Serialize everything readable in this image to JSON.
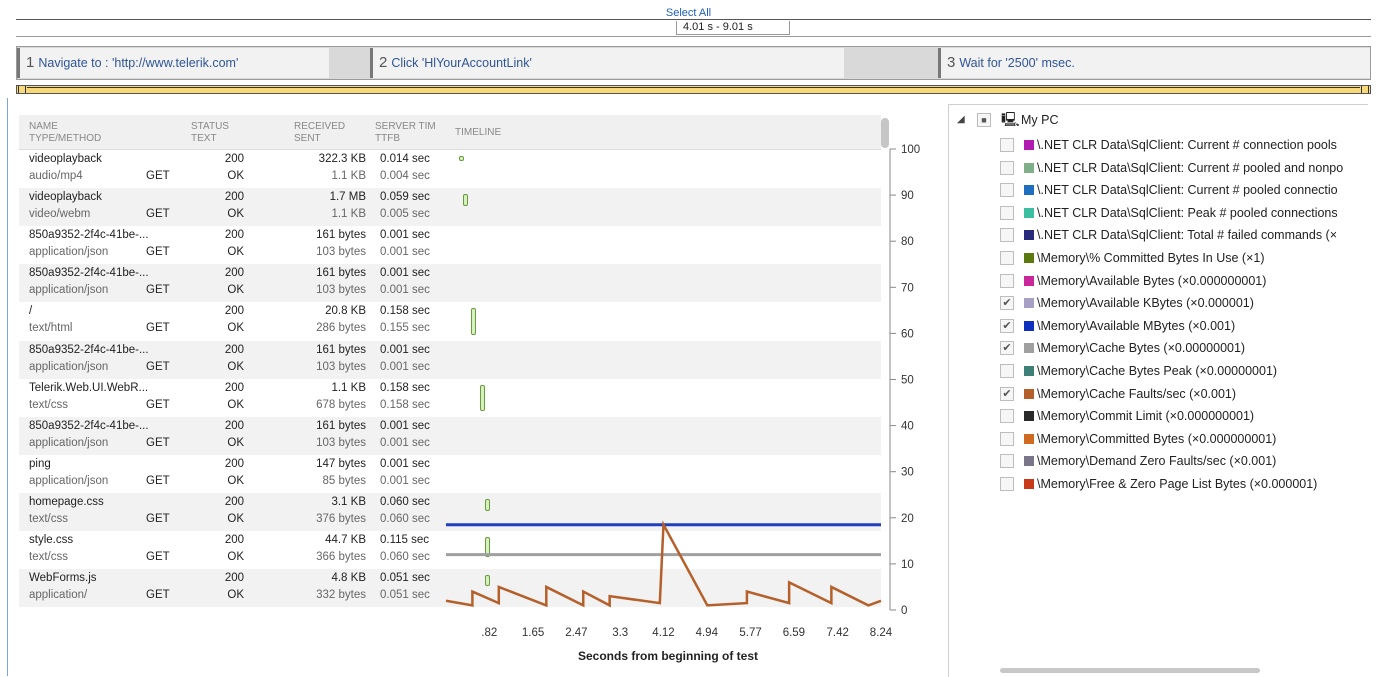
{
  "top": {
    "select_all": "Select All",
    "range": "4.01 s - 9.01 s"
  },
  "steps": [
    {
      "num": "1",
      "label": "Navigate to : 'http://www.telerik.com'"
    },
    {
      "num": "2",
      "label": "Click 'HlYourAccountLink'"
    },
    {
      "num": "3",
      "label": "Wait for '2500' msec."
    }
  ],
  "table": {
    "headers": {
      "name": "NAME",
      "type": "TYPE/METHOD",
      "status": "STATUS",
      "text": "TEXT",
      "received": "RECEIVED",
      "sent": "SENT",
      "server": "SERVER TIM",
      "ttfb": "TTFB",
      "timeline": "TIMELINE"
    },
    "rows": [
      {
        "name": "videoplayback",
        "type": "audio/mp4",
        "method": "GET",
        "status": "200",
        "text": "OK",
        "received": "322.3 KB",
        "sent": "1.1 KB",
        "server": "0.014 sec",
        "ttfb": "0.004 sec"
      },
      {
        "name": "videoplayback",
        "type": "video/webm",
        "method": "GET",
        "status": "200",
        "text": "OK",
        "received": "1.7 MB",
        "sent": "1.1 KB",
        "server": "0.059 sec",
        "ttfb": "0.005 sec"
      },
      {
        "name": "850a9352-2f4c-41be-...",
        "type": "application/json",
        "method": "GET",
        "status": "200",
        "text": "OK",
        "received": "161 bytes",
        "sent": "103 bytes",
        "server": "0.001 sec",
        "ttfb": "0.001 sec"
      },
      {
        "name": "850a9352-2f4c-41be-...",
        "type": "application/json",
        "method": "GET",
        "status": "200",
        "text": "OK",
        "received": "161 bytes",
        "sent": "103 bytes",
        "server": "0.001 sec",
        "ttfb": "0.001 sec"
      },
      {
        "name": "/",
        "type": "text/html",
        "method": "GET",
        "status": "200",
        "text": "OK",
        "received": "20.8 KB",
        "sent": "286 bytes",
        "server": "0.158 sec",
        "ttfb": "0.155 sec"
      },
      {
        "name": "850a9352-2f4c-41be-...",
        "type": "application/json",
        "method": "GET",
        "status": "200",
        "text": "OK",
        "received": "161 bytes",
        "sent": "103 bytes",
        "server": "0.001 sec",
        "ttfb": "0.001 sec"
      },
      {
        "name": "Telerik.Web.UI.WebR...",
        "type": "text/css",
        "method": "GET",
        "status": "200",
        "text": "OK",
        "received": "1.1 KB",
        "sent": "678 bytes",
        "server": "0.158 sec",
        "ttfb": "0.158 sec"
      },
      {
        "name": "850a9352-2f4c-41be-...",
        "type": "application/json",
        "method": "GET",
        "status": "200",
        "text": "OK",
        "received": "161 bytes",
        "sent": "103 bytes",
        "server": "0.001 sec",
        "ttfb": "0.001 sec"
      },
      {
        "name": "ping",
        "type": "application/json",
        "method": "GET",
        "status": "200",
        "text": "OK",
        "received": "147 bytes",
        "sent": "85 bytes",
        "server": "0.001 sec",
        "ttfb": "0.001 sec"
      },
      {
        "name": "homepage.css",
        "type": "text/css",
        "method": "GET",
        "status": "200",
        "text": "OK",
        "received": "3.1 KB",
        "sent": "376 bytes",
        "server": "0.060 sec",
        "ttfb": "0.060 sec"
      },
      {
        "name": "style.css",
        "type": "text/css",
        "method": "GET",
        "status": "200",
        "text": "OK",
        "received": "44.7 KB",
        "sent": "366 bytes",
        "server": "0.115 sec",
        "ttfb": "0.060 sec"
      },
      {
        "name": "WebForms.js",
        "type": "application/",
        "method": "GET",
        "status": "200",
        "text": "OK",
        "received": "4.8 KB",
        "sent": "332 bytes",
        "server": "0.051 sec",
        "ttfb": "0.051 sec"
      }
    ],
    "timeline_bars": [
      {
        "start": 0.09,
        "duration": 0.014
      },
      {
        "start": 0.12,
        "duration": 0.059
      },
      null,
      null,
      {
        "start": 0.18,
        "duration": 0.158
      },
      null,
      {
        "start": 0.24,
        "duration": 0.158
      },
      null,
      null,
      {
        "start": 0.28,
        "duration": 0.06
      },
      {
        "start": 0.28,
        "duration": 0.115
      },
      {
        "start": 0.28,
        "duration": 0.051
      }
    ]
  },
  "chart_data": {
    "type": "line",
    "xlabel": "Seconds from beginning of test",
    "x_ticks": [
      ".82",
      "1.65",
      "2.47",
      "3.3",
      "4.12",
      "4.94",
      "5.77",
      "6.59",
      "7.42",
      "8.24"
    ],
    "xlim": [
      0,
      8.24
    ],
    "ylim": [
      0,
      100
    ],
    "y_ticks": [
      "100",
      "90",
      "80",
      "70",
      "60",
      "50",
      "40",
      "30",
      "20",
      "10",
      "0"
    ],
    "series": [
      {
        "color": "#1f3fbf",
        "x": [
          0,
          8.24
        ],
        "y": [
          18.5,
          18.5
        ]
      },
      {
        "color": "#a0a0a0",
        "x": [
          0,
          8.24
        ],
        "y": [
          12,
          12
        ]
      },
      {
        "color": "#b5602a",
        "x": [
          0,
          0.5,
          0.5,
          1.0,
          1.0,
          1.9,
          1.9,
          2.6,
          2.6,
          3.1,
          3.1,
          4.05,
          4.12,
          4.95,
          4.95,
          5.7,
          5.7,
          6.5,
          6.5,
          7.3,
          7.3,
          8.0,
          8.24
        ],
        "y": [
          2,
          1,
          4,
          1.5,
          5,
          1,
          5,
          1,
          4,
          1,
          3,
          1.5,
          18.5,
          1,
          1,
          1.5,
          4,
          1.5,
          6,
          1.5,
          5,
          1,
          2
        ]
      }
    ]
  },
  "tree": {
    "root": "My PC",
    "items": [
      {
        "label": "\\.NET CLR Data\\SqlClient: Current # connection pools",
        "color": "#b01cb0",
        "checked": false
      },
      {
        "label": "\\.NET CLR Data\\SqlClient: Current # pooled and nonpo",
        "color": "#7fb08a",
        "checked": false
      },
      {
        "label": "\\.NET CLR Data\\SqlClient: Current # pooled connectio",
        "color": "#1e6fc0",
        "checked": false
      },
      {
        "label": "\\.NET CLR Data\\SqlClient: Peak # pooled connections",
        "color": "#3cbfa0",
        "checked": false
      },
      {
        "label": "\\.NET CLR Data\\SqlClient: Total # failed commands (×",
        "color": "#2a2a7a",
        "checked": false
      },
      {
        "label": "\\Memory\\% Committed Bytes In Use (×1)",
        "color": "#5a7a10",
        "checked": false
      },
      {
        "label": "\\Memory\\Available Bytes (×0.000000001)",
        "color": "#c8289a",
        "checked": false
      },
      {
        "label": "\\Memory\\Available KBytes (×0.000001)",
        "color": "#a7a0c4",
        "checked": true
      },
      {
        "label": "\\Memory\\Available MBytes (×0.001)",
        "color": "#1030c0",
        "checked": true
      },
      {
        "label": "\\Memory\\Cache Bytes (×0.00000001)",
        "color": "#a0a0a0",
        "checked": true
      },
      {
        "label": "\\Memory\\Cache Bytes Peak (×0.00000001)",
        "color": "#3e8078",
        "checked": false
      },
      {
        "label": "\\Memory\\Cache Faults/sec (×0.001)",
        "color": "#b5602a",
        "checked": true
      },
      {
        "label": "\\Memory\\Commit Limit (×0.000000001)",
        "color": "#2a2a2a",
        "checked": false
      },
      {
        "label": "\\Memory\\Committed Bytes (×0.000000001)",
        "color": "#d06a20",
        "checked": false
      },
      {
        "label": "\\Memory\\Demand Zero Faults/sec (×0.001)",
        "color": "#7a7588",
        "checked": false
      },
      {
        "label": "\\Memory\\Free & Zero Page List Bytes (×0.000001)",
        "color": "#c83a1a",
        "checked": false
      }
    ]
  }
}
